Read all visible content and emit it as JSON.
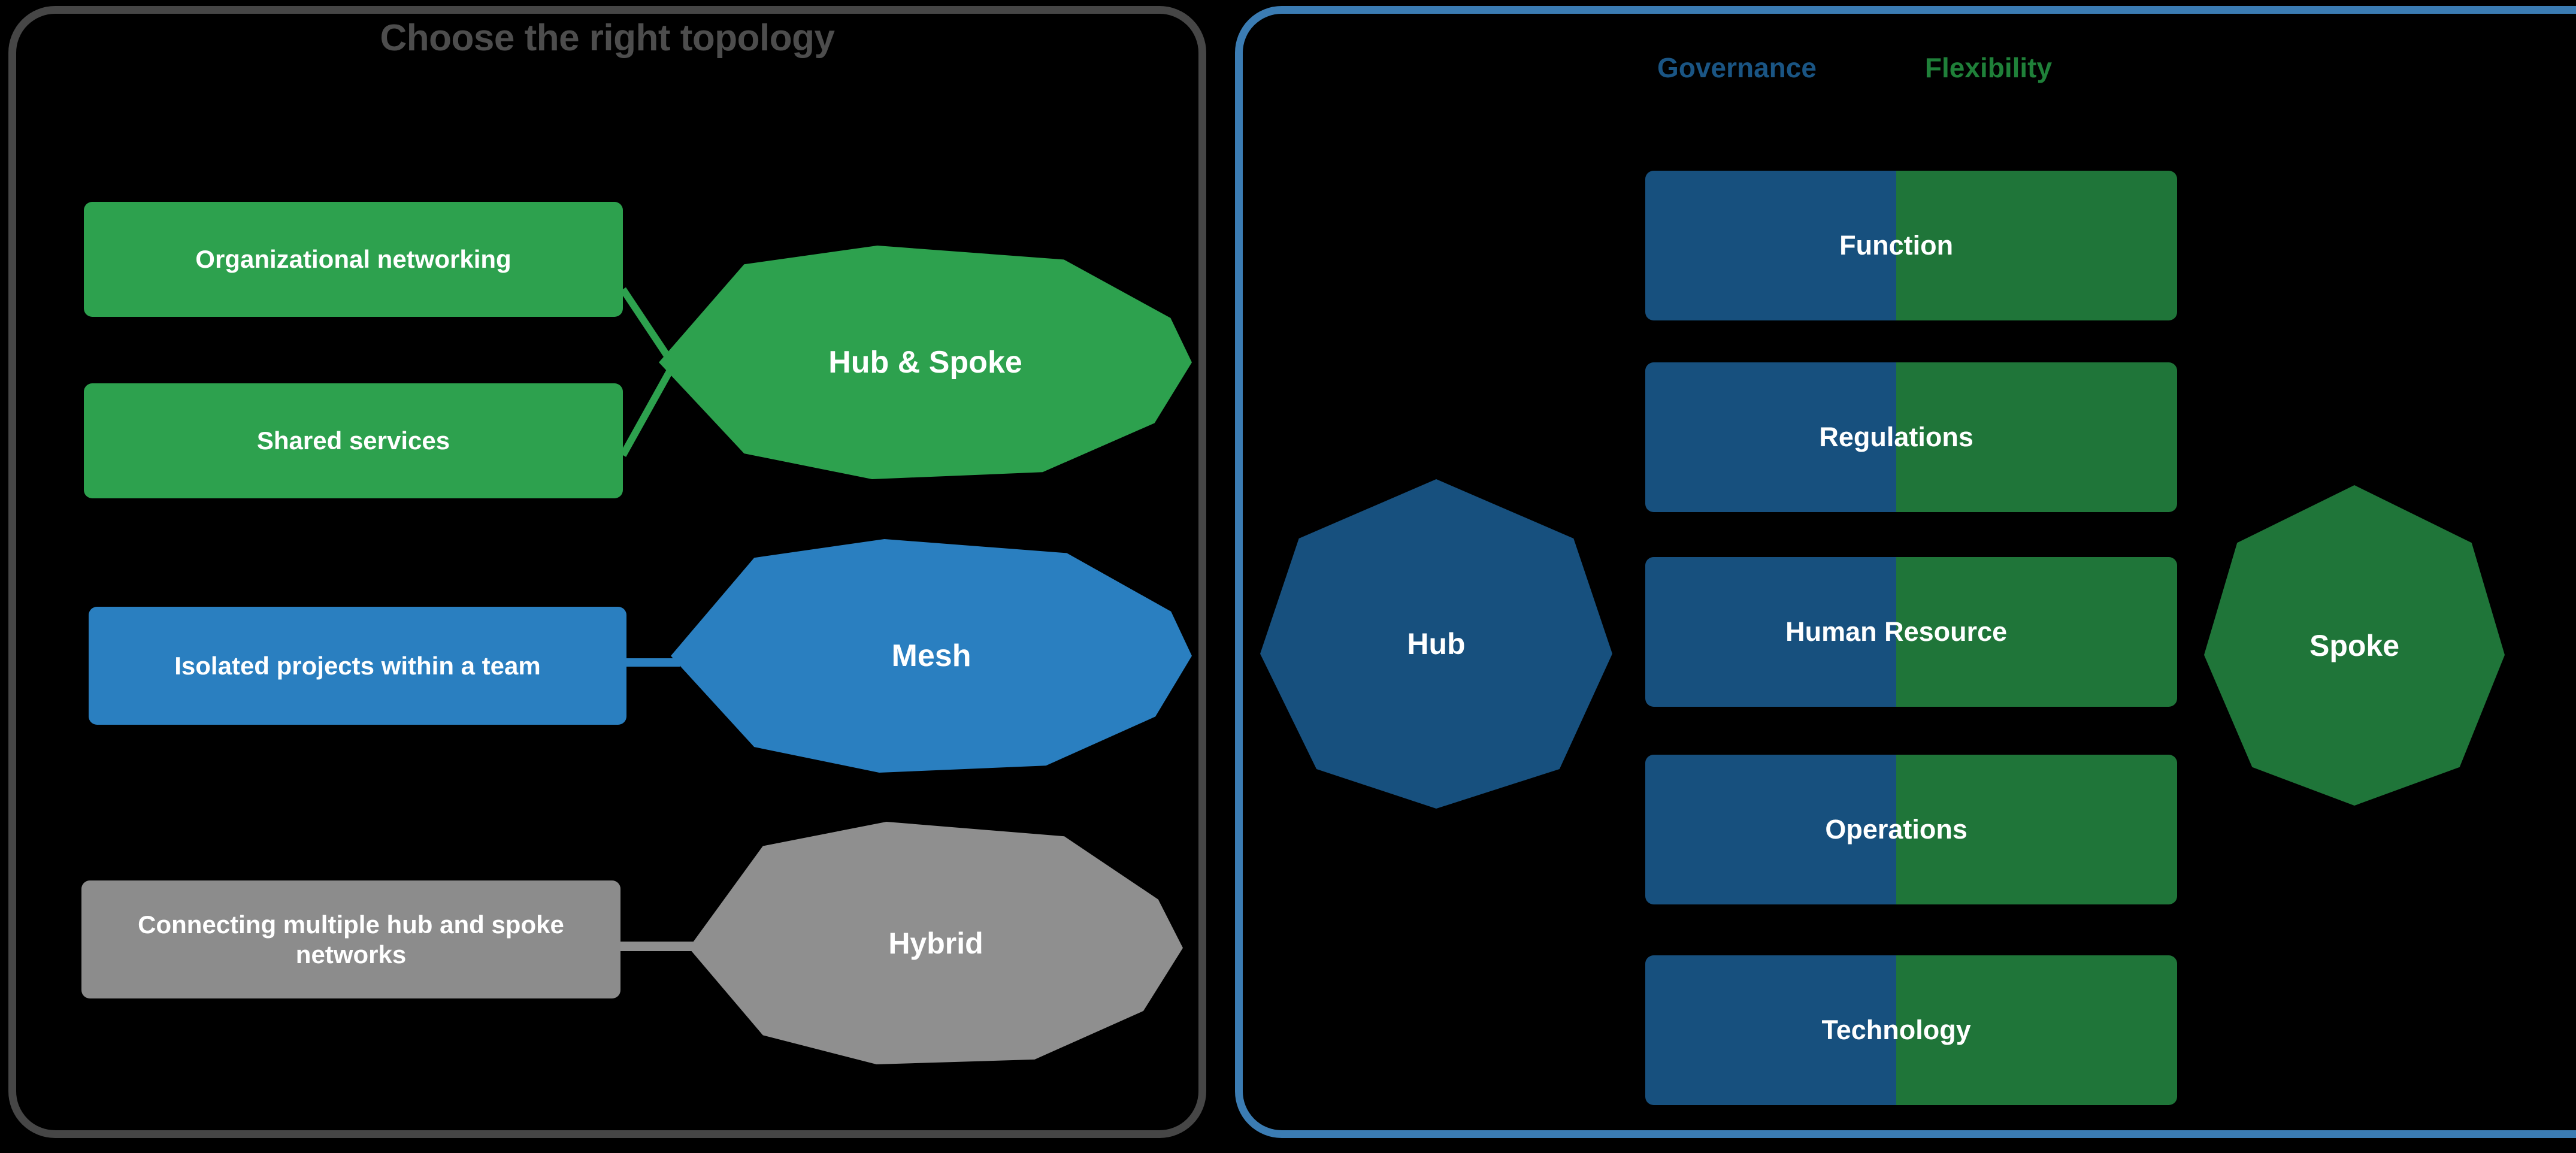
{
  "left_panel": {
    "title": "Choose the right topology",
    "border_color": "#464646",
    "rows": [
      {
        "boxes": [
          "Organizational networking",
          "Shared services"
        ],
        "shape_label": "Hub & Spoke",
        "color": "#2da14e"
      },
      {
        "boxes": [
          "Isolated projects within a team"
        ],
        "shape_label": "Mesh",
        "color": "#2a7fc0"
      },
      {
        "boxes": [
          "Connecting multiple hub and spoke networks"
        ],
        "shape_label": "Hybrid",
        "color": "#8c8c8c"
      }
    ],
    "box_labels": {
      "organizational_networking": "Organizational networking",
      "shared_services": "Shared services",
      "isolated_projects": "Isolated projects within a team",
      "connecting_networks": "Connecting multiple hub and spoke networks"
    },
    "shape_labels": {
      "hub_and_spoke": "Hub & Spoke",
      "mesh": "Mesh",
      "hybrid": "Hybrid"
    }
  },
  "right_panel": {
    "border_color": "#3b7cb3",
    "legend": {
      "governance": "Governance",
      "governance_color": "#1a5584",
      "flexibility": "Flexibility",
      "flexibility_color": "#1f8039"
    },
    "hub_label": "Hub",
    "hub_color": "#17507e",
    "spoke_label": "Spoke",
    "spoke_color": "#1f7539",
    "cards": [
      {
        "label": "Function"
      },
      {
        "label": "Regulations"
      },
      {
        "label": "Human Resource"
      },
      {
        "label": "Operations"
      },
      {
        "label": "Technology"
      }
    ]
  }
}
